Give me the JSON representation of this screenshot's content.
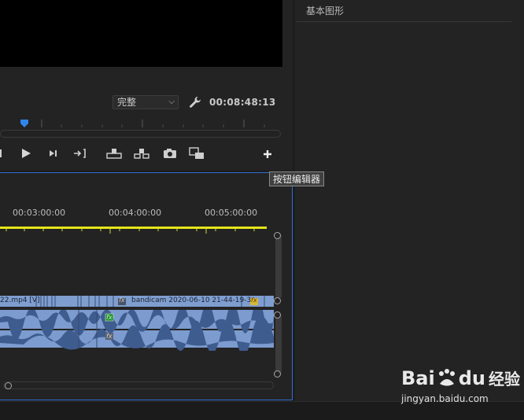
{
  "program_monitor": {
    "quality": "完整",
    "timecode": "00:08:48:13"
  },
  "tooltip": {
    "text": "按钮编辑器"
  },
  "timeline": {
    "ruler_labels": [
      "00:03:00:00",
      "00:04:00:00",
      "00:05:00:00"
    ],
    "clip_left_label": "22.mp4 [V]",
    "clip_right_label": "bandicam 2020-06-10 21-44-19-3",
    "fx_label": "fx"
  },
  "essential_graphics": {
    "title": "基本图形"
  },
  "watermark": {
    "brand": "Bai",
    "brand2": "du",
    "cn": "经验",
    "url": "jingyan.baidu.com"
  },
  "colors": {
    "accent_blue": "#2f6fd6",
    "work_area_yellow": "#e5e41a",
    "clip_blue": "#7f9ed0"
  }
}
